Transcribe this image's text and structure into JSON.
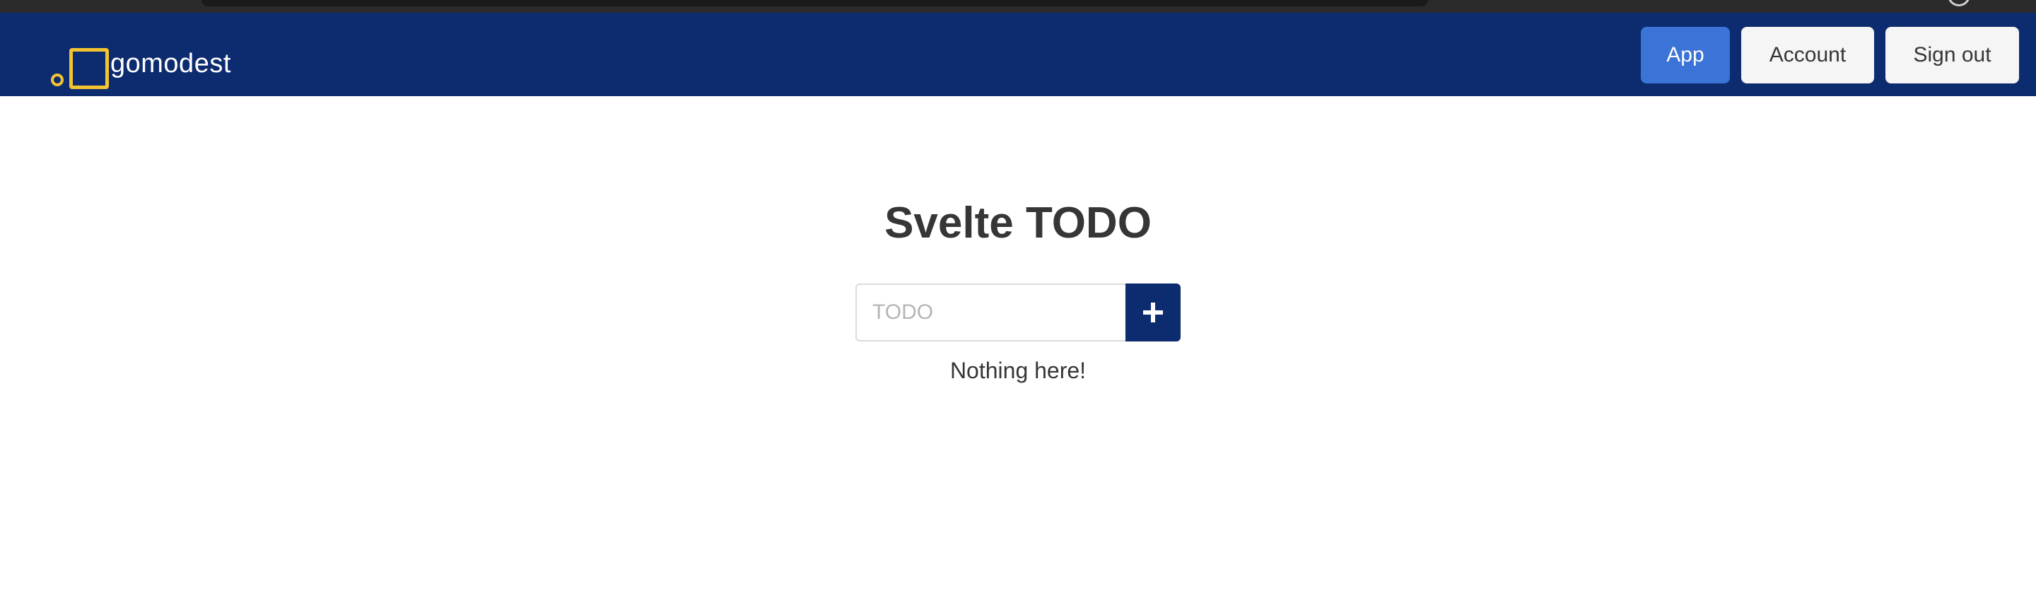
{
  "navbar": {
    "brand_name": "gomodest",
    "buttons": {
      "app": "App",
      "account": "Account",
      "sign_out": "Sign out"
    }
  },
  "main": {
    "title": "Svelte TODO",
    "todo_input": {
      "placeholder": "TODO",
      "value": ""
    },
    "add_button_icon": "plus-icon",
    "empty_message": "Nothing here!"
  },
  "colors": {
    "navbar_bg": "#0d2c70",
    "logo_accent": "#f4c430",
    "primary_button": "#3b73d6",
    "light_button": "#f5f5f5",
    "text": "#363636"
  }
}
